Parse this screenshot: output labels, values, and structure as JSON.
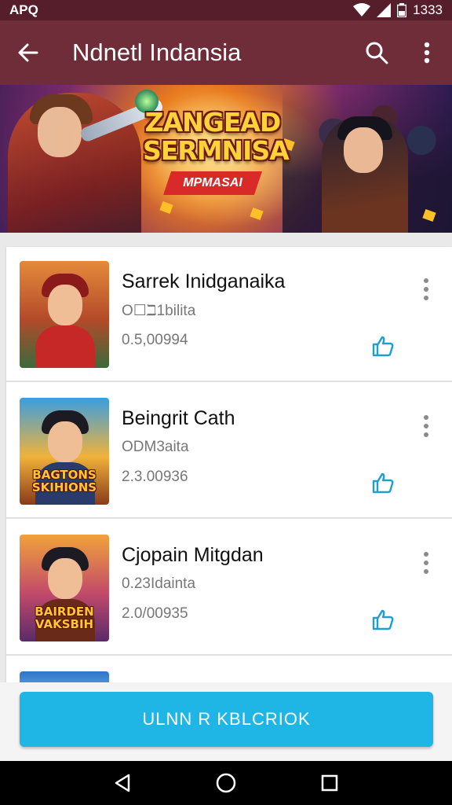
{
  "status_bar": {
    "left_text": "APQ",
    "time": "1333",
    "icons": [
      "wifi-icon",
      "signal-icon",
      "battery-icon"
    ]
  },
  "app_bar": {
    "title": "Ndnetl Indansia",
    "icons": [
      "back-arrow-icon",
      "search-icon",
      "more-vertical-icon"
    ]
  },
  "banner": {
    "title_line1": "ZANGEAD",
    "title_line2": "SERMNISA",
    "ribbon": "MPMASAI"
  },
  "list": {
    "items": [
      {
        "title": "Sarrek Inidganaika",
        "subtitle": "O☐ℶ1bilita",
        "size": "0.5,00994",
        "thumb_text": ""
      },
      {
        "title": "Beingrit Cath",
        "subtitle": "ODM3aita",
        "size": "2.3.00936",
        "thumb_text": "BAGTONS SKIHIONS"
      },
      {
        "title": "Cjopain Mitgdan",
        "subtitle": "0.23Idainta",
        "size": "2.0/00935",
        "thumb_text": "BAIRDEN VAKSBIH"
      }
    ]
  },
  "cta": {
    "label": "ULNN R KBLCRIOK"
  },
  "nav": {
    "icons": [
      "back-triangle-icon",
      "home-circle-icon",
      "recents-square-icon"
    ]
  },
  "colors": {
    "status_bar": "#561e2b",
    "app_bar": "#6f2d3a",
    "accent": "#1fb6e6"
  }
}
